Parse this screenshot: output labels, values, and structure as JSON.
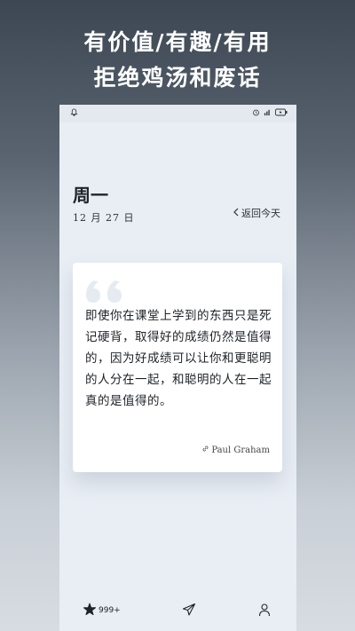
{
  "promo": {
    "line1": "有价值/有趣/有用",
    "line2": "拒绝鸡汤和废话"
  },
  "status_bar": {
    "left_icon": "bell-icon",
    "right_icons": [
      "alarm-icon",
      "signal-icon",
      "battery-icon"
    ]
  },
  "header": {
    "day": "周一",
    "date": "12 月 27 日",
    "back_today": "返回今天"
  },
  "quote": {
    "text": "即使你在课堂上学到的东西只是死记硬背，取得好的成绩仍然是值得的，因为好成绩可以让你和更聪明的人分在一起，和聪明的人在一起真的是值得的。",
    "author": "Paul Graham"
  },
  "bottom_nav": {
    "favorites_count": "999+",
    "items": [
      "star-icon",
      "send-icon",
      "user-icon"
    ]
  },
  "colors": {
    "page_bg": "#e9eef5",
    "card_bg": "#ffffff",
    "quote_mark": "#e6eaf1",
    "text_primary": "#1e2228"
  }
}
